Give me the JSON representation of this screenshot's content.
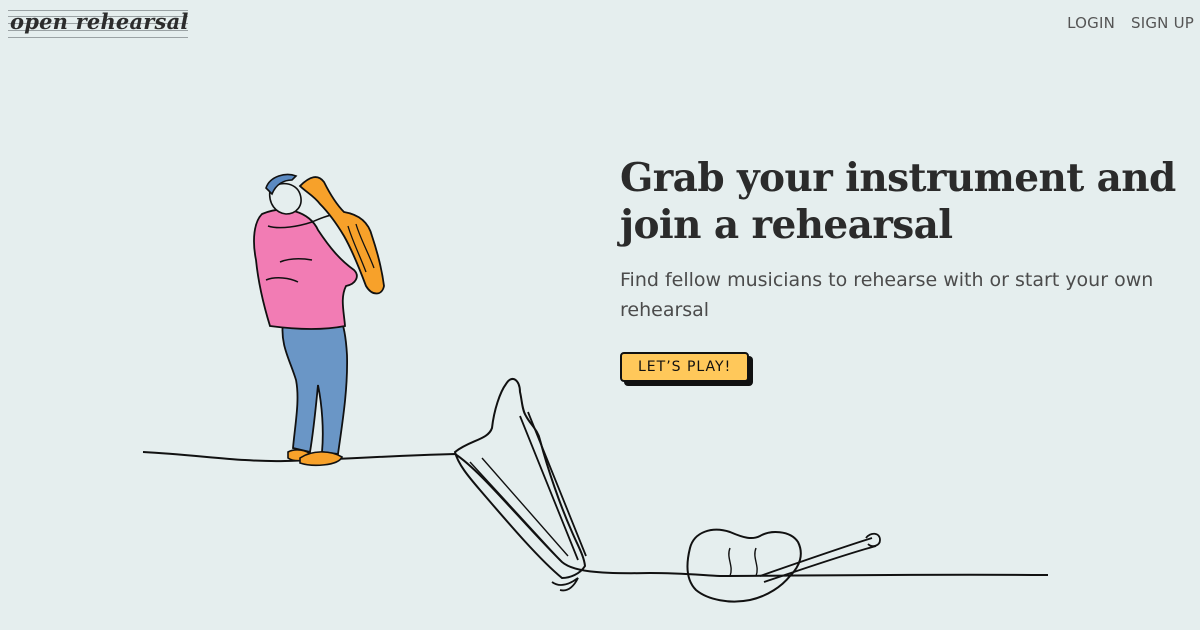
{
  "header": {
    "brand_name": "open rehearsal",
    "nav": {
      "login_label": "LOGIN",
      "signup_label": "SIGN UP"
    }
  },
  "hero": {
    "headline": "Grab your instrument and join a rehearsal",
    "subtitle": "Find fellow musicians to rehearse with or start your own rehearsal",
    "cta_label": "LET’S PLAY!"
  },
  "colors": {
    "background": "#e5eeee",
    "cta": "#ffc85a",
    "shirt": "#f27cb4",
    "pants": "#6a96c6",
    "saxophone": "#f7a12a",
    "cap": "#5b8ac2"
  },
  "illustration": {
    "subjects": [
      "saxophone-player",
      "harp",
      "double-bass"
    ]
  }
}
